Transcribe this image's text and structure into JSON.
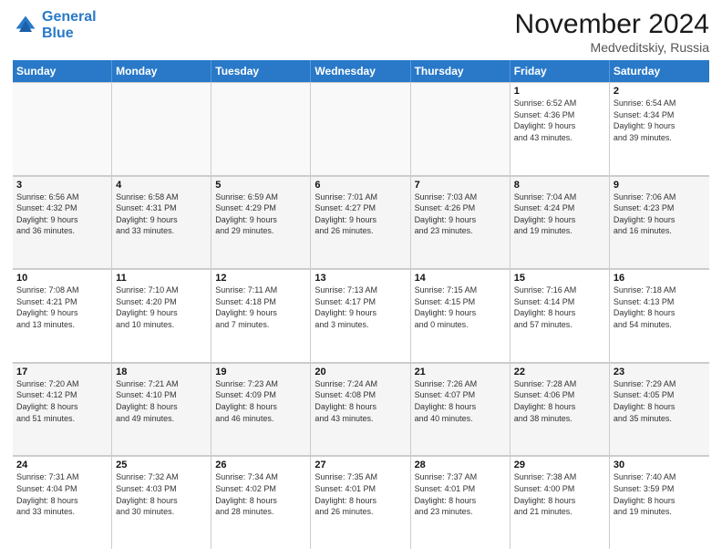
{
  "header": {
    "logo_line1": "General",
    "logo_line2": "Blue",
    "month_title": "November 2024",
    "location": "Medveditskiy, Russia"
  },
  "days_of_week": [
    "Sunday",
    "Monday",
    "Tuesday",
    "Wednesday",
    "Thursday",
    "Friday",
    "Saturday"
  ],
  "weeks": [
    [
      {
        "day": "",
        "info": ""
      },
      {
        "day": "",
        "info": ""
      },
      {
        "day": "",
        "info": ""
      },
      {
        "day": "",
        "info": ""
      },
      {
        "day": "",
        "info": ""
      },
      {
        "day": "1",
        "info": "Sunrise: 6:52 AM\nSunset: 4:36 PM\nDaylight: 9 hours\nand 43 minutes."
      },
      {
        "day": "2",
        "info": "Sunrise: 6:54 AM\nSunset: 4:34 PM\nDaylight: 9 hours\nand 39 minutes."
      }
    ],
    [
      {
        "day": "3",
        "info": "Sunrise: 6:56 AM\nSunset: 4:32 PM\nDaylight: 9 hours\nand 36 minutes."
      },
      {
        "day": "4",
        "info": "Sunrise: 6:58 AM\nSunset: 4:31 PM\nDaylight: 9 hours\nand 33 minutes."
      },
      {
        "day": "5",
        "info": "Sunrise: 6:59 AM\nSunset: 4:29 PM\nDaylight: 9 hours\nand 29 minutes."
      },
      {
        "day": "6",
        "info": "Sunrise: 7:01 AM\nSunset: 4:27 PM\nDaylight: 9 hours\nand 26 minutes."
      },
      {
        "day": "7",
        "info": "Sunrise: 7:03 AM\nSunset: 4:26 PM\nDaylight: 9 hours\nand 23 minutes."
      },
      {
        "day": "8",
        "info": "Sunrise: 7:04 AM\nSunset: 4:24 PM\nDaylight: 9 hours\nand 19 minutes."
      },
      {
        "day": "9",
        "info": "Sunrise: 7:06 AM\nSunset: 4:23 PM\nDaylight: 9 hours\nand 16 minutes."
      }
    ],
    [
      {
        "day": "10",
        "info": "Sunrise: 7:08 AM\nSunset: 4:21 PM\nDaylight: 9 hours\nand 13 minutes."
      },
      {
        "day": "11",
        "info": "Sunrise: 7:10 AM\nSunset: 4:20 PM\nDaylight: 9 hours\nand 10 minutes."
      },
      {
        "day": "12",
        "info": "Sunrise: 7:11 AM\nSunset: 4:18 PM\nDaylight: 9 hours\nand 7 minutes."
      },
      {
        "day": "13",
        "info": "Sunrise: 7:13 AM\nSunset: 4:17 PM\nDaylight: 9 hours\nand 3 minutes."
      },
      {
        "day": "14",
        "info": "Sunrise: 7:15 AM\nSunset: 4:15 PM\nDaylight: 9 hours\nand 0 minutes."
      },
      {
        "day": "15",
        "info": "Sunrise: 7:16 AM\nSunset: 4:14 PM\nDaylight: 8 hours\nand 57 minutes."
      },
      {
        "day": "16",
        "info": "Sunrise: 7:18 AM\nSunset: 4:13 PM\nDaylight: 8 hours\nand 54 minutes."
      }
    ],
    [
      {
        "day": "17",
        "info": "Sunrise: 7:20 AM\nSunset: 4:12 PM\nDaylight: 8 hours\nand 51 minutes."
      },
      {
        "day": "18",
        "info": "Sunrise: 7:21 AM\nSunset: 4:10 PM\nDaylight: 8 hours\nand 49 minutes."
      },
      {
        "day": "19",
        "info": "Sunrise: 7:23 AM\nSunset: 4:09 PM\nDaylight: 8 hours\nand 46 minutes."
      },
      {
        "day": "20",
        "info": "Sunrise: 7:24 AM\nSunset: 4:08 PM\nDaylight: 8 hours\nand 43 minutes."
      },
      {
        "day": "21",
        "info": "Sunrise: 7:26 AM\nSunset: 4:07 PM\nDaylight: 8 hours\nand 40 minutes."
      },
      {
        "day": "22",
        "info": "Sunrise: 7:28 AM\nSunset: 4:06 PM\nDaylight: 8 hours\nand 38 minutes."
      },
      {
        "day": "23",
        "info": "Sunrise: 7:29 AM\nSunset: 4:05 PM\nDaylight: 8 hours\nand 35 minutes."
      }
    ],
    [
      {
        "day": "24",
        "info": "Sunrise: 7:31 AM\nSunset: 4:04 PM\nDaylight: 8 hours\nand 33 minutes."
      },
      {
        "day": "25",
        "info": "Sunrise: 7:32 AM\nSunset: 4:03 PM\nDaylight: 8 hours\nand 30 minutes."
      },
      {
        "day": "26",
        "info": "Sunrise: 7:34 AM\nSunset: 4:02 PM\nDaylight: 8 hours\nand 28 minutes."
      },
      {
        "day": "27",
        "info": "Sunrise: 7:35 AM\nSunset: 4:01 PM\nDaylight: 8 hours\nand 26 minutes."
      },
      {
        "day": "28",
        "info": "Sunrise: 7:37 AM\nSunset: 4:01 PM\nDaylight: 8 hours\nand 23 minutes."
      },
      {
        "day": "29",
        "info": "Sunrise: 7:38 AM\nSunset: 4:00 PM\nDaylight: 8 hours\nand 21 minutes."
      },
      {
        "day": "30",
        "info": "Sunrise: 7:40 AM\nSunset: 3:59 PM\nDaylight: 8 hours\nand 19 minutes."
      }
    ]
  ]
}
